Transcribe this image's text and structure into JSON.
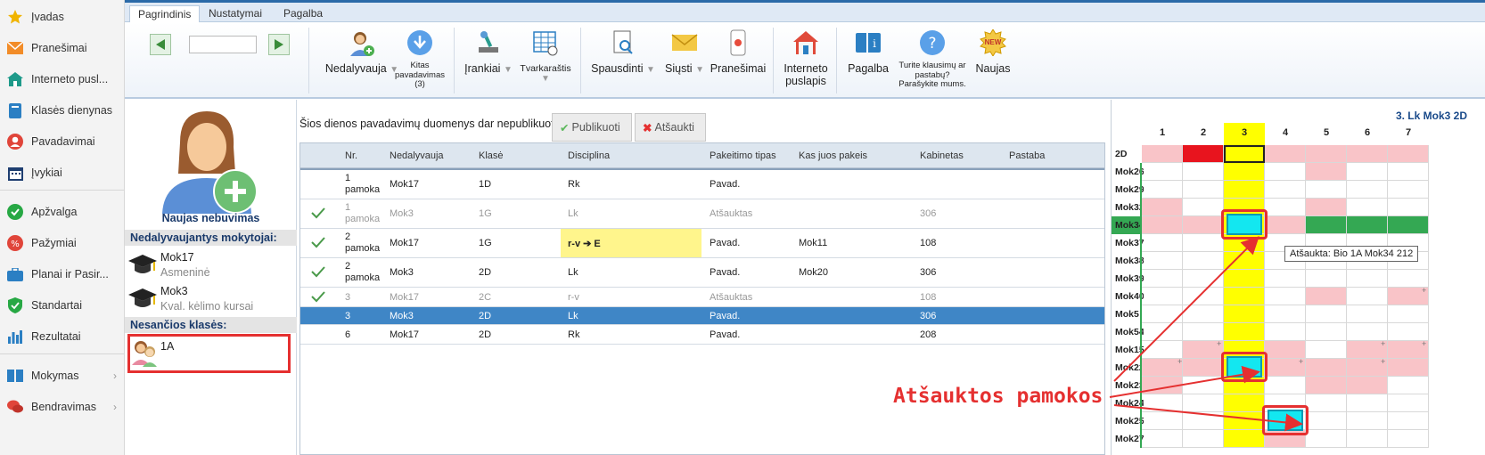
{
  "sidebar": {
    "items": [
      {
        "label": "Įvadas",
        "icon": "star-icon"
      },
      {
        "label": "Pranešimai",
        "icon": "envelope-icon"
      },
      {
        "label": "Interneto pusl...",
        "icon": "home-icon"
      },
      {
        "label": "Klasės dienynas",
        "icon": "book-icon"
      },
      {
        "label": "Pavadavimai",
        "icon": "user-icon"
      },
      {
        "label": "Įvykiai",
        "icon": "calendar-icon"
      },
      {
        "label": "Apžvalga",
        "icon": "check-circle-icon"
      },
      {
        "label": "Pažymiai",
        "icon": "grades-icon"
      },
      {
        "label": "Planai ir Pasir...",
        "icon": "briefcase-icon"
      },
      {
        "label": "Standartai",
        "icon": "shield-icon"
      },
      {
        "label": "Rezultatai",
        "icon": "bar-chart-icon"
      },
      {
        "label": "Mokymas",
        "icon": "education-icon"
      },
      {
        "label": "Bendravimas",
        "icon": "chat-icon"
      }
    ]
  },
  "tabs": [
    "Pagrindinis",
    "Nustatymai",
    "Pagalba"
  ],
  "ribbon": {
    "nedalyvauja": "Nedalyvauja",
    "kitas": "Kitas pavadavimas (3)",
    "irankiai": "Įrankiai",
    "tvarkarastis": "Tvarkaraštis",
    "spausdinti": "Spausdinti",
    "siusti": "Siųsti",
    "pranesimai": "Pranešimai",
    "internetas": "Interneto puslapis",
    "pagalba": "Pagalba",
    "klausimai": "Turite klausimų ar pastabų? Parašykite mums.",
    "naujas": "Naujas",
    "new_badge": "NEW"
  },
  "left": {
    "new_absence": "Naujas nebuvimas",
    "absent_teachers_header": "Nedalyvaujantys mokytojai:",
    "teachers": [
      {
        "name": "Mok17",
        "reason": "Asmeninė"
      },
      {
        "name": "Mok3",
        "reason": "Kval. kėlimo kursai"
      }
    ],
    "absent_classes_header": "Nesančios klasės:",
    "absent_class": "1A"
  },
  "main": {
    "info": "Šios dienos pavadavimų duomenys dar nepublikuoti.",
    "publish": "Publikuoti",
    "cancel": "Atšaukti",
    "headers": [
      "Nr.",
      "Nedalyvauja",
      "Klasė",
      "Disciplina",
      "Pakeitimo tipas",
      "Kas juos pakeis",
      "Kabinetas",
      "Pastaba"
    ],
    "rows": [
      {
        "nr1": "1",
        "nr2": "pamoka",
        "absent": "Mok17",
        "cls": "1D",
        "disc": "Rk",
        "type": "Pavad.",
        "repl": "",
        "room": "",
        "note": ""
      },
      {
        "nr1": "1",
        "nr2": "pamoka",
        "absent": "Mok3",
        "cls": "1G",
        "disc": "Lk",
        "type": "Atšauktas",
        "repl": "",
        "room": "306",
        "note": ""
      },
      {
        "nr1": "2",
        "nr2": "pamoka",
        "absent": "Mok17",
        "cls": "1G",
        "disc": "r-v ➔ E",
        "type": "Pavad.",
        "repl": "Mok11",
        "room": "108",
        "note": ""
      },
      {
        "nr1": "2",
        "nr2": "pamoka",
        "absent": "Mok3",
        "cls": "2D",
        "disc": "Lk",
        "type": "Pavad.",
        "repl": "Mok20",
        "room": "306",
        "note": ""
      },
      {
        "nr1": "3",
        "nr2": "",
        "absent": "Mok17",
        "cls": "2C",
        "disc": "r-v",
        "type": "Atšauktas",
        "repl": "",
        "room": "108",
        "note": ""
      },
      {
        "nr1": "3",
        "nr2": "",
        "absent": "Mok3",
        "cls": "2D",
        "disc": "Lk",
        "type": "Pavad.",
        "repl": "",
        "room": "306",
        "note": ""
      },
      {
        "nr1": "6",
        "nr2": "",
        "absent": "Mok17",
        "cls": "2D",
        "disc": "Rk",
        "type": "Pavad.",
        "repl": "",
        "room": "208",
        "note": ""
      }
    ]
  },
  "grid": {
    "title": "3. Lk Mok3 2D",
    "cols": [
      "1",
      "2",
      "3",
      "4",
      "5",
      "6",
      "7"
    ],
    "first_row": "2D",
    "rows": [
      "Mok26",
      "Mok29",
      "Mok32",
      "Mok34",
      "Mok37",
      "Mok38",
      "Mok39",
      "Mok40",
      "Mok5",
      "Mok54",
      "Mok15",
      "Mok22",
      "Mok23",
      "Mok24",
      "Mok25",
      "Mok27"
    ],
    "tooltip": "Atšaukta: Bio 1A Mok34 212",
    "annotation": "Atšauktos pamokos"
  },
  "colors": {
    "accent": "#3f86c6",
    "cancel_box": "#13e7f0",
    "annotation": "#e53030",
    "highlight_col": "#ffff00"
  }
}
